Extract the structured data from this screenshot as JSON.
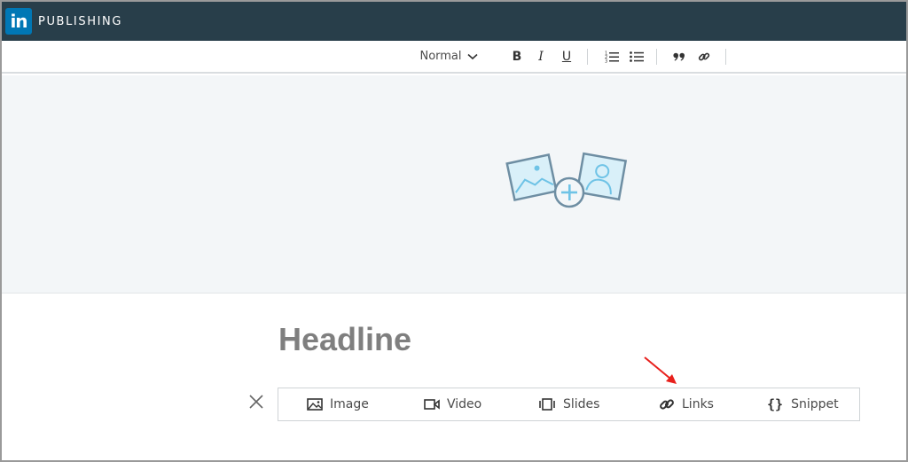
{
  "header": {
    "logo_text": "in",
    "brand": "PUBLISHING"
  },
  "toolbar": {
    "text_style": "Normal",
    "buttons": [
      {
        "name": "bold",
        "label": "B"
      },
      {
        "name": "italic",
        "label": "I"
      },
      {
        "name": "underline",
        "label": "U"
      },
      {
        "name": "numbered-list",
        "icon": "numbered-list-icon"
      },
      {
        "name": "bulleted-list",
        "icon": "bulleted-list-icon"
      },
      {
        "name": "quote",
        "icon": "quote-icon"
      },
      {
        "name": "link",
        "icon": "link-icon"
      }
    ]
  },
  "cover": {
    "icon": "add-image-icon"
  },
  "editor": {
    "headline_placeholder": "Headline"
  },
  "insert_bar": {
    "items": [
      {
        "label": "Image",
        "icon": "image-icon"
      },
      {
        "label": "Video",
        "icon": "video-icon"
      },
      {
        "label": "Slides",
        "icon": "slides-icon"
      },
      {
        "label": "Links",
        "icon": "link-icon"
      },
      {
        "label": "Snippet",
        "icon": "braces-icon"
      }
    ],
    "close_icon": "close-icon"
  },
  "annotation": {
    "color": "#e8201c"
  },
  "colors": {
    "topbar": "#283e4a",
    "brand_blue": "#0077b5",
    "cover_bg": "#f3f6f8",
    "icon_blue": "#6fc3e6"
  }
}
